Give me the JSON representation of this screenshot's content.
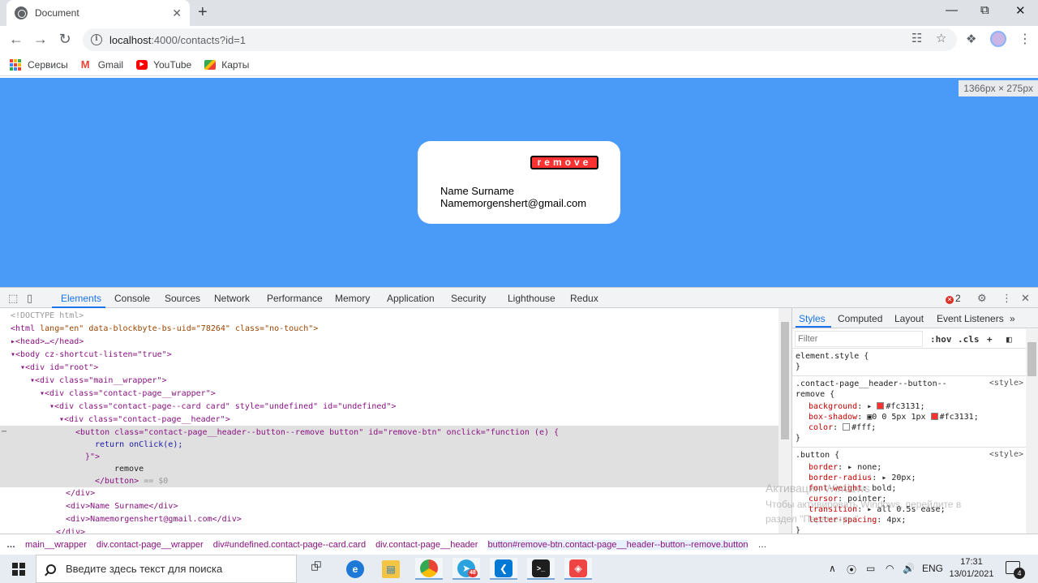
{
  "browser": {
    "tab_title": "Document",
    "tab_close": "✕",
    "new_tab": "+",
    "url_host": "localhost",
    "url_path": ":4000/contacts?id=1",
    "bookmarks": [
      {
        "label": "Сервисы",
        "icon": "apps-grid-icon"
      },
      {
        "label": "Gmail",
        "icon": "gmail-icon"
      },
      {
        "label": "YouTube",
        "icon": "youtube-icon"
      },
      {
        "label": "Карты",
        "icon": "maps-icon"
      }
    ]
  },
  "viewport": {
    "size_badge": "1366px × 275px",
    "background": "#4a9bf8"
  },
  "card": {
    "button_label": "remove",
    "button_color": "#fc3131",
    "name": "Name Surname",
    "email": "Namemorgenshert@gmail.com"
  },
  "devtools": {
    "tabs": [
      "Elements",
      "Console",
      "Sources",
      "Network",
      "Performance",
      "Memory",
      "Application",
      "Security",
      "Lighthouse",
      "Redux"
    ],
    "error_count": "2",
    "dom": {
      "doctype": "<!DOCTYPE html>",
      "html_open": "<html",
      "html_attrs": " lang=\"en\" data-blockbyte-bs-uid=\"78264\" class=\"no-touch\">",
      "head": "▸<head>…</head>",
      "body": "▾<body cz-shortcut-listen=\"true\">",
      "root": "▾<div id=\"root\">",
      "main_wrapper": "▾<div class=\"main__wrapper\">",
      "contact_wrapper": "▾<div class=\"contact-page__wrapper\">",
      "card": "▾<div class=\"contact-page--card card\" style=\"undefined\" id=\"undefined\">",
      "header": "▾<div class=\"contact-page__header\">",
      "button_open": "<button class=\"contact-page__header--button--remove button\" id=\"remove-btn\" onclick=\"function (e) {",
      "button_body": "return onClick(e);",
      "button_close_attr": "}\">",
      "button_text": "remove",
      "button_close": "</button>",
      "button_eq": " == $0",
      "div_close": "</div>",
      "name_div": "<div>Name Surname</div>",
      "email_div": "<div>Namemorgenshert@gmail.com</div>",
      "div_close_2": "</div>"
    },
    "styles": {
      "tabs": [
        "Styles",
        "Computed",
        "Layout",
        "Event Listeners"
      ],
      "filter_placeholder": "Filter",
      "hov": ":hov",
      "cls": ".cls",
      "element_style": "element.style {",
      "close_brace": "}",
      "rule1_selector_a": ".contact-page__header--button--",
      "rule1_selector_b": "remove {",
      "rule1_source": "<style>",
      "rule1_props": [
        {
          "name": "background",
          "value": "#fc3131;",
          "swatch": "#fc3131"
        },
        {
          "name": "box-shadow",
          "value": "0 0 5px 1px",
          "swatch": "#fc3131",
          "value2": "#fc3131;"
        },
        {
          "name": "color",
          "value": "#fff;",
          "swatch": "#ffffff"
        }
      ],
      "rule2_selector": ".button {",
      "rule2_source": "<style>",
      "rule2_props": [
        {
          "name": "border",
          "value": "▸ none;"
        },
        {
          "name": "border-radius",
          "value": "▸ 20px;"
        },
        {
          "name": "font-weight",
          "value": "bold;"
        },
        {
          "name": "cursor",
          "value": "pointer;"
        },
        {
          "name": "transition",
          "value": "▸ all 0.5s ease;"
        },
        {
          "name": "letter-spacing",
          "value": "4px;"
        }
      ],
      "watermark_title": "Активация Windows",
      "watermark_line1": "Чтобы активировать Windows, перейдите в",
      "watermark_line2": "раздел \"Параметры\"."
    },
    "breadcrumbs": [
      "…",
      "main__wrapper",
      "div.contact-page__wrapper",
      "div#undefined.contact-page--card.card",
      "div.contact-page__header",
      "button#remove-btn.contact-page__header--button--remove.button",
      "…"
    ]
  },
  "taskbar": {
    "search_placeholder": "Введите здесь текст для поиска",
    "lang": "ENG",
    "time": "17:31",
    "date": "13/01/2021",
    "notifications": "4",
    "telegram_badge": "48"
  }
}
